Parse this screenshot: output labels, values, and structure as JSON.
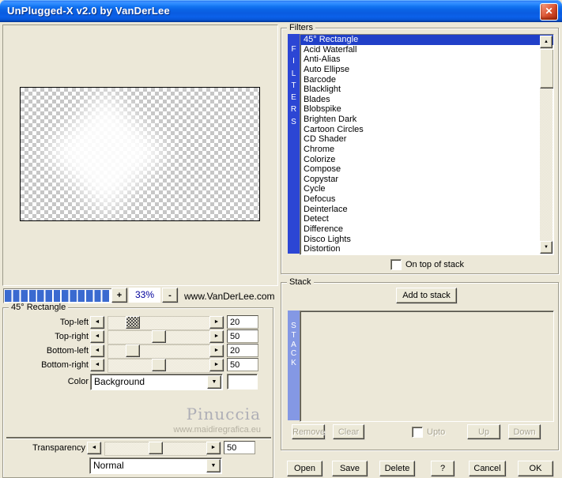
{
  "window": {
    "title": "UnPlugged-X v2.0 by VanDerLee",
    "close_glyph": "✕"
  },
  "zoom_bar": {
    "plus_label": "+",
    "zoom_level": "33%",
    "minus_label": "-",
    "website": "www.VanDerLee.com",
    "progress_segments": 13
  },
  "params": {
    "group_title": "45° Rectangle",
    "sliders": [
      {
        "label": "Top-left",
        "value": "20",
        "pos": 20
      },
      {
        "label": "Top-right",
        "value": "50",
        "pos": 50
      },
      {
        "label": "Bottom-left",
        "value": "20",
        "pos": 20
      },
      {
        "label": "Bottom-right",
        "value": "50",
        "pos": 50
      }
    ],
    "color_label": "Color",
    "color_value": "Background",
    "watermark": "Pinuccia",
    "watermark_url": "www.maidiregrafica.eu",
    "transparency": {
      "label": "Transparency",
      "value": "50",
      "pos": 50
    },
    "blend_mode": "Normal"
  },
  "filters": {
    "group_title": "Filters",
    "side_letters": [
      "F",
      "I",
      "L",
      "T",
      "E",
      "R",
      "S"
    ],
    "items": [
      "45° Rectangle",
      "Acid Waterfall",
      "Anti-Alias",
      "Auto Ellipse",
      "Barcode",
      "Blacklight",
      "Blades",
      "Blobspike",
      "Brighten Dark",
      "Cartoon Circles",
      "CD Shader",
      "Chrome",
      "Colorize",
      "Compose",
      "Copystar",
      "Cycle",
      "Defocus",
      "Deinterlace",
      "Detect",
      "Difference",
      "Disco Lights",
      "Distortion"
    ],
    "selected_item": "45° Rectangle",
    "on_top_label": "On top of stack"
  },
  "stack": {
    "group_title": "Stack",
    "side_letters": [
      "S",
      "T",
      "A",
      "C",
      "K"
    ],
    "add_button": "Add to stack",
    "remove_button": "Remove",
    "clear_button": "Clear",
    "upto_label": "Upto",
    "up_button": "Up",
    "down_button": "Down"
  },
  "footer": {
    "open": "Open",
    "save": "Save",
    "delete": "Delete",
    "help": "?",
    "cancel": "Cancel",
    "ok": "OK"
  },
  "glyphs": {
    "left_arrow": "◄",
    "right_arrow": "►",
    "up_arrow": "▲",
    "down_arrow": "▼"
  },
  "colors": {
    "titlebar_blue": "#0A5CE0",
    "dialog_bg": "#ECE8D8",
    "filters_bar_blue": "#2C46D4",
    "selection_blue": "#2140C8",
    "stack_bar_blue": "#8498E4",
    "progress_segment_blue": "#3A6AD0",
    "zoom_text_navy": "#00009B",
    "close_button_red": "#D8512E",
    "watermark_gray": "#AEAEB6"
  }
}
